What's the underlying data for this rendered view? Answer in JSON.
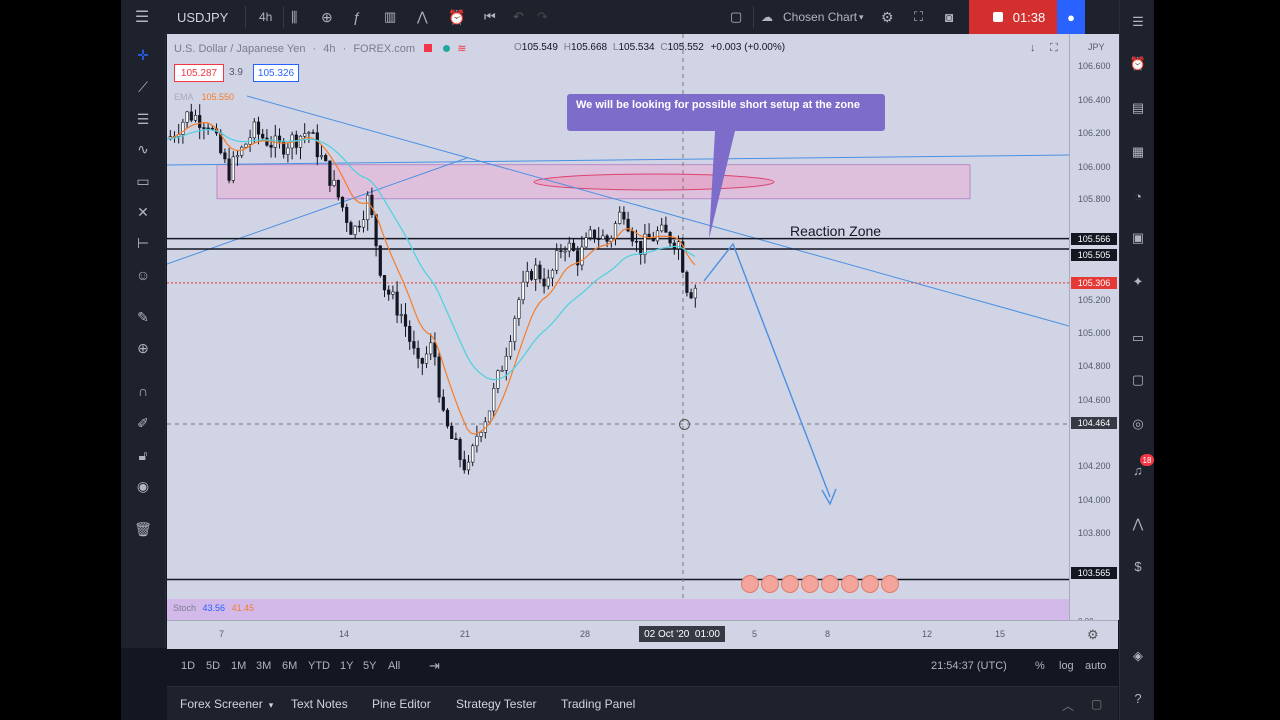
{
  "toolbar": {
    "symbol": "USDJPY",
    "interval": "4h",
    "layout_name": "Chosen Chart",
    "recording_time": "01:38"
  },
  "chart": {
    "title": "U.S. Dollar / Japanese Yen",
    "interval": "4h",
    "exchange": "FOREX.com",
    "ohlc": {
      "open": "105.549",
      "high": "105.668",
      "low": "105.534",
      "close": "105.552",
      "change": "+0.003",
      "change_pct": "(+0.00%)"
    },
    "sell_price": "105.287",
    "spread": "3.9",
    "buy_price": "105.326",
    "ema_label": "EMA",
    "ema_value": "105.550",
    "currency": "JPY",
    "callout_text": "We will be looking for possible short setup at the zone",
    "zone_label": "Reaction Zone",
    "stoch_label": "Stoch",
    "stoch_k": "43.56",
    "stoch_d": "41.45",
    "stoch_axis": "0.00",
    "colors": {
      "bull": "#ffffff",
      "bear": "#131722",
      "ema_fast": "#f57c2a",
      "ema_slow": "#4dd0e1",
      "trend": "#4a90e2",
      "zone": "#e6b8d8",
      "current_price": "#e53935"
    }
  },
  "price_axis": {
    "labels": [
      "106.600",
      "106.400",
      "106.200",
      "106.000",
      "105.800",
      "105.200",
      "105.000",
      "104.800",
      "104.600",
      "104.200",
      "104.000",
      "103.800"
    ],
    "tags": {
      "line_high": "105.566",
      "line_low": "105.505",
      "current": "105.306",
      "crosshair": "104.464",
      "line_bottom": "103.565"
    }
  },
  "time_axis": {
    "labels": [
      "7",
      "14",
      "21",
      "28",
      "5",
      "8",
      "12",
      "15"
    ],
    "crosshair_date": "02 Oct '20",
    "crosshair_time": "01:00"
  },
  "range_bar": {
    "ranges": [
      "1D",
      "5D",
      "1M",
      "3M",
      "6M",
      "YTD",
      "1Y",
      "5Y",
      "All"
    ],
    "clock": "21:54:37 (UTC)",
    "percent": "%",
    "log": "log",
    "auto": "auto"
  },
  "bottom_tabs": [
    "Forex Screener",
    "Text Notes",
    "Pine Editor",
    "Strategy Tester",
    "Trading Panel"
  ],
  "notifications": "18",
  "chart_data": {
    "type": "candlestick",
    "symbol": "USDJPY",
    "x": [
      "7",
      "14",
      "21",
      "28",
      "02 Oct '20",
      "5",
      "8",
      "12",
      "15"
    ],
    "y_range": [
      103.6,
      106.7
    ],
    "horizontal_levels": [
      105.566,
      105.505,
      105.306,
      103.565
    ],
    "zone": [
      105.8,
      106.0
    ],
    "projected_target": 104.0
  }
}
